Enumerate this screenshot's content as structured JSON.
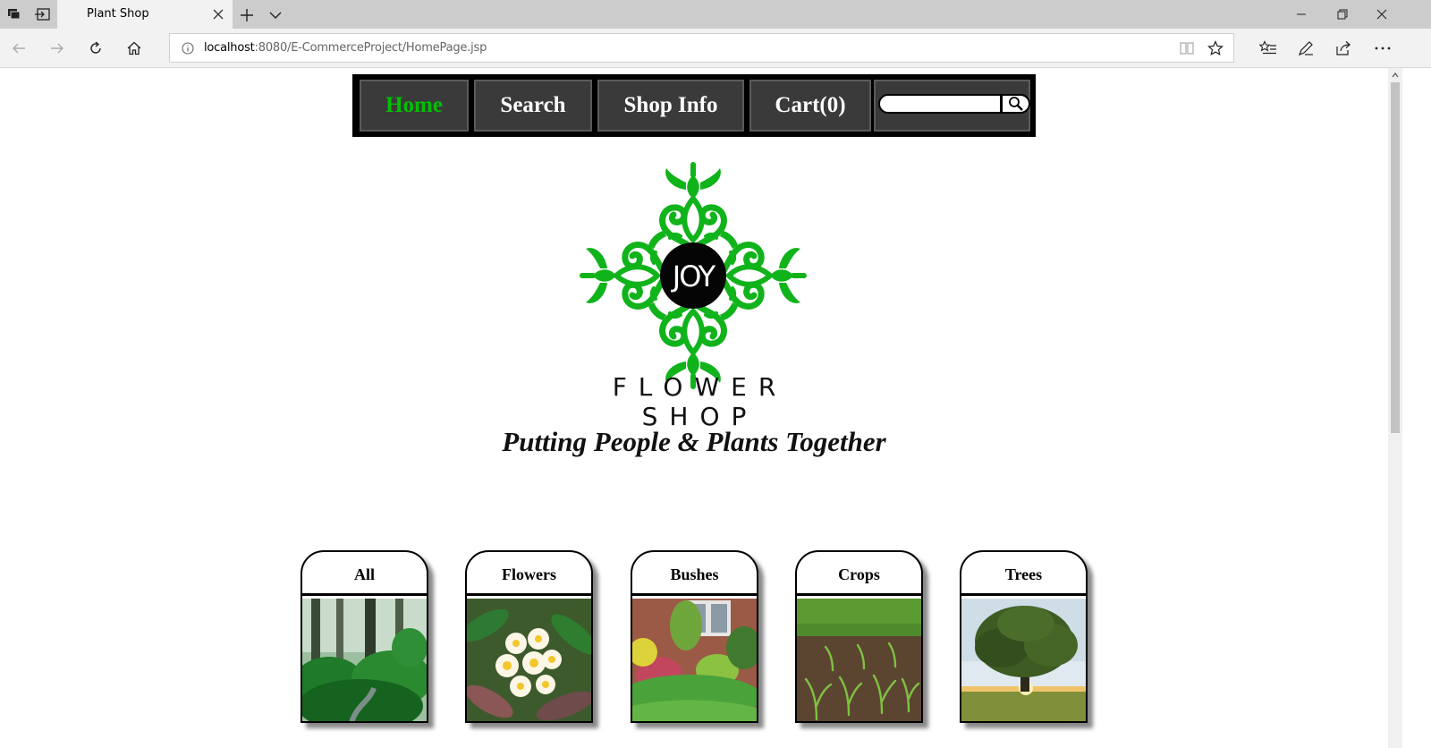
{
  "browser": {
    "tab_title": "Plant Shop",
    "url_host": "localhost",
    "url_rest": ":8080/E-CommerceProject/HomePage.jsp"
  },
  "nav": {
    "items": [
      {
        "label": "Home",
        "active": true
      },
      {
        "label": "Search"
      },
      {
        "label": "Shop Info"
      },
      {
        "label": "Cart(0)"
      }
    ],
    "search_value": ""
  },
  "logo": {
    "badge": "JOY",
    "shop_name": "FLOWER SHOP",
    "accent": "#11b31b"
  },
  "tagline": "Putting People & Plants Together",
  "categories": [
    {
      "label": "All"
    },
    {
      "label": "Flowers"
    },
    {
      "label": "Bushes"
    },
    {
      "label": "Crops"
    },
    {
      "label": "Trees"
    }
  ]
}
